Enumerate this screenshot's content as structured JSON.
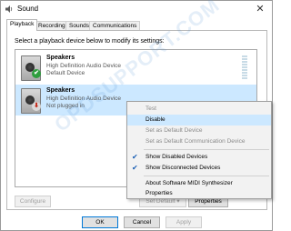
{
  "window": {
    "title": "Sound",
    "close_glyph": "✕",
    "app_icon": "speaker-icon"
  },
  "tabs": [
    {
      "label": "Playback"
    },
    {
      "label": "Recording"
    },
    {
      "label": "Sounds"
    },
    {
      "label": "Communications"
    }
  ],
  "instruction": "Select a playback device below to modify its settings:",
  "devices": [
    {
      "name": "Speakers",
      "driver": "High Definition Audio Device",
      "status": "Default Device",
      "badge": "✔"
    },
    {
      "name": "Speakers",
      "driver": "High Definition Audio Device",
      "status": "Not plugged in",
      "badge": "⬇"
    }
  ],
  "buttons": {
    "configure": "Configure",
    "set_default": "Set Default",
    "set_default_arrow": "▾",
    "properties": "Properties",
    "ok": "OK",
    "cancel": "Cancel",
    "apply": "Apply"
  },
  "context_menu": {
    "items": [
      {
        "label": "Test"
      },
      {
        "label": "Disable"
      },
      {
        "label": "Set as Default Device"
      },
      {
        "label": "Set as Default Communication Device"
      },
      {
        "label": "Show Disabled Devices",
        "check": "✔"
      },
      {
        "label": "Show Disconnected Devices",
        "check": "✔"
      },
      {
        "label": "About Software MIDI Synthesizer"
      },
      {
        "label": "Properties"
      }
    ]
  },
  "watermark": "OPDSUPPORT.COM",
  "colors": {
    "selection": "#cce8ff",
    "default_badge": "#2e9e3e",
    "not_plugged_badge": "#c42b1c",
    "check": "#1a5fb4"
  }
}
